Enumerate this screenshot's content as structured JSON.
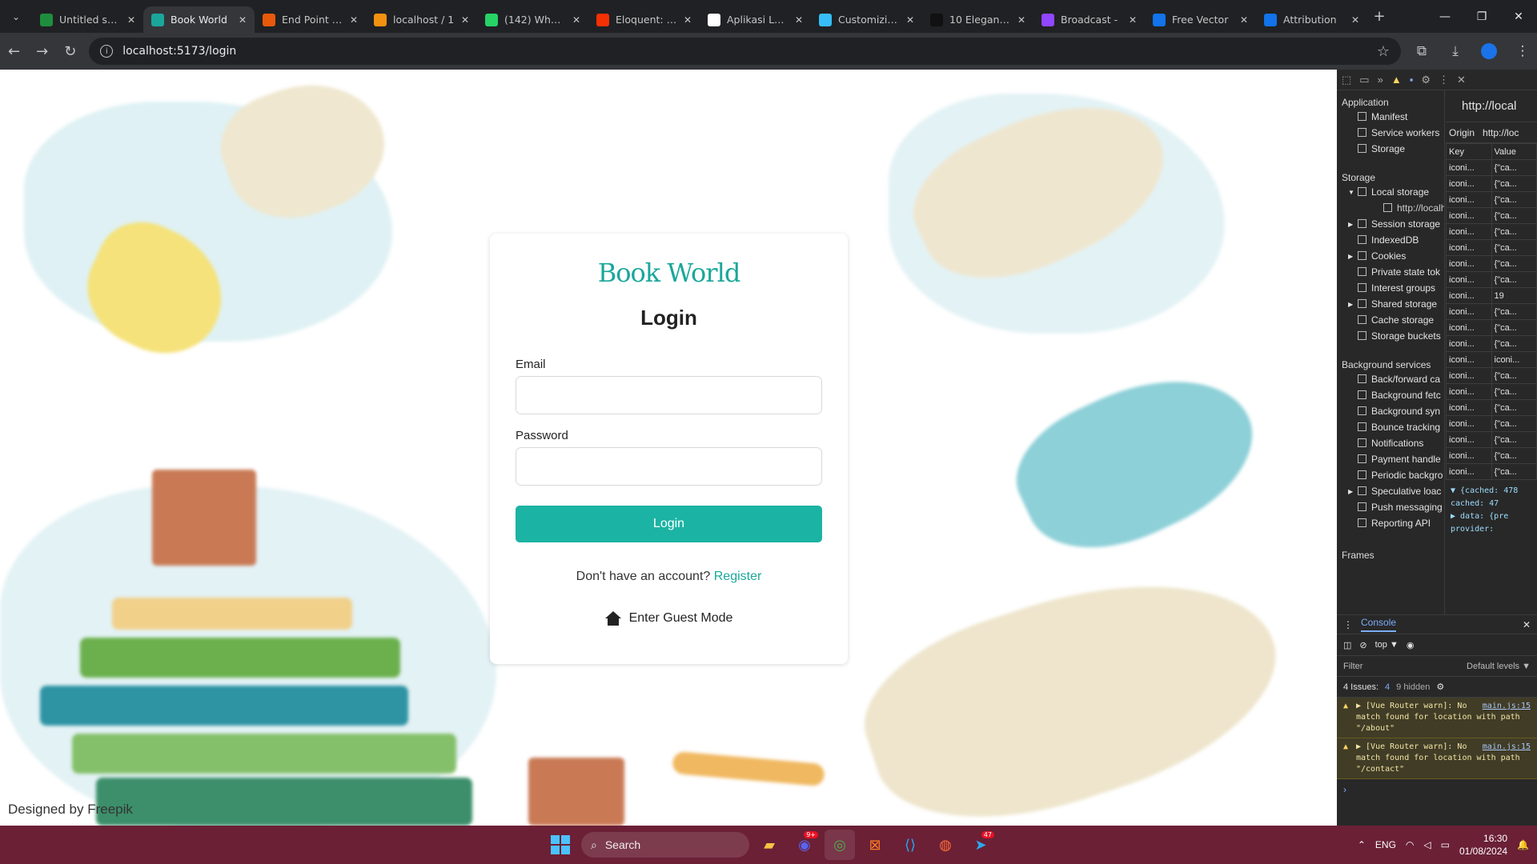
{
  "browser": {
    "tabs": [
      {
        "title": "Untitled spre",
        "color": "#1e8e3e"
      },
      {
        "title": "Book World",
        "color": "#1aa79a",
        "active": true
      },
      {
        "title": "End Point Pe",
        "color": "#e8590c"
      },
      {
        "title": "localhost / 1",
        "color": "#f29111"
      },
      {
        "title": "(142) Whats/",
        "color": "#25d366"
      },
      {
        "title": "Eloquent: Fa",
        "color": "#f53003"
      },
      {
        "title": "Aplikasi Lara",
        "color": "#ffffff"
      },
      {
        "title": "Customizing",
        "color": "#38bdf8"
      },
      {
        "title": "10 Elegant G",
        "color": "#111111"
      },
      {
        "title": "Broadcast -",
        "color": "#9146ff"
      },
      {
        "title": "Free Vector",
        "color": "#1273eb"
      },
      {
        "title": "Attribution",
        "color": "#1273eb"
      }
    ],
    "url": "localhost:5173/login"
  },
  "page": {
    "logo": "Book World",
    "heading": "Login",
    "email_label": "Email",
    "password_label": "Password",
    "login_button": "Login",
    "register_prompt": "Don't have an account?",
    "register_link": "Register",
    "guest_mode": "Enter Guest Mode",
    "credit": "Designed by Freepik"
  },
  "devtools": {
    "application_section": "Application",
    "application_items": [
      "Manifest",
      "Service workers",
      "Storage"
    ],
    "storage_section": "Storage",
    "storage_items": [
      "Local storage",
      "http://localho",
      "Session storage",
      "IndexedDB",
      "Cookies",
      "Private state tok",
      "Interest groups",
      "Shared storage",
      "Cache storage",
      "Storage buckets"
    ],
    "bg_section": "Background services",
    "bg_items": [
      "Back/forward ca",
      "Background fetc",
      "Background syn",
      "Bounce tracking",
      "Notifications",
      "Payment handle",
      "Periodic backgro",
      "Speculative loac",
      "Push messaging",
      "Reporting API"
    ],
    "frames_section": "Frames",
    "url_short": "http://local",
    "origin_label": "Origin",
    "origin_value": "http://loc",
    "table_headers": [
      "Key",
      "Value"
    ],
    "table_rows": [
      [
        "iconi...",
        "{\"ca..."
      ],
      [
        "iconi...",
        "{\"ca..."
      ],
      [
        "iconi...",
        "{\"ca..."
      ],
      [
        "iconi...",
        "{\"ca..."
      ],
      [
        "iconi...",
        "{\"ca..."
      ],
      [
        "iconi...",
        "{\"ca..."
      ],
      [
        "iconi...",
        "{\"ca..."
      ],
      [
        "iconi...",
        "{\"ca..."
      ],
      [
        "iconi...",
        "19"
      ],
      [
        "iconi...",
        "{\"ca..."
      ],
      [
        "iconi...",
        "{\"ca..."
      ],
      [
        "iconi...",
        "{\"ca..."
      ],
      [
        "iconi...",
        "iconi..."
      ],
      [
        "iconi...",
        "{\"ca..."
      ],
      [
        "iconi...",
        "{\"ca..."
      ],
      [
        "iconi...",
        "{\"ca..."
      ],
      [
        "iconi...",
        "{\"ca..."
      ],
      [
        "iconi...",
        "{\"ca..."
      ],
      [
        "iconi...",
        "{\"ca..."
      ],
      [
        "iconi...",
        "{\"ca..."
      ]
    ],
    "obj_lines": [
      "▼ {cached: 478",
      "cached: 47",
      "▶ data: {pre",
      "provider:"
    ],
    "console_tab": "Console",
    "context": "top ▼",
    "filter": "Filter",
    "levels": "Default levels ▼",
    "issues": "4 Issues:",
    "issues_count": "4",
    "hidden": "9 hidden",
    "warnings": [
      {
        "text": "▶ [Vue Router warn]: No match found for location with path \"/about\"",
        "src": "main.js:15"
      },
      {
        "text": "▶ [Vue Router warn]: No match found for location with path \"/contact\"",
        "src": "main.js:15"
      }
    ]
  },
  "taskbar": {
    "search": "Search",
    "lang": "ENG",
    "time": "16:30",
    "date": "01/08/2024"
  }
}
